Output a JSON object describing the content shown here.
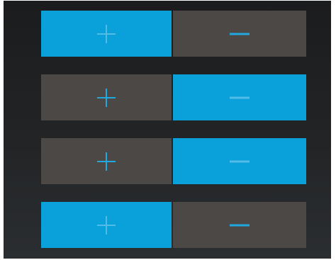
{
  "colors": {
    "panel_background": "#222426",
    "active_button": "#0aa0d9",
    "inactive_button": "#4b4845",
    "icon_on_inactive": "#22a7df",
    "icon_on_active": "#5fc2e8"
  },
  "rows": [
    {
      "plus": {
        "icon": "plus-icon",
        "state": "on"
      },
      "minus": {
        "icon": "minus-icon",
        "state": "off"
      }
    },
    {
      "plus": {
        "icon": "plus-icon",
        "state": "off"
      },
      "minus": {
        "icon": "minus-icon",
        "state": "on"
      }
    },
    {
      "plus": {
        "icon": "plus-icon",
        "state": "off"
      },
      "minus": {
        "icon": "minus-icon",
        "state": "on"
      }
    },
    {
      "plus": {
        "icon": "plus-icon",
        "state": "on"
      },
      "minus": {
        "icon": "minus-icon",
        "state": "off"
      }
    }
  ]
}
